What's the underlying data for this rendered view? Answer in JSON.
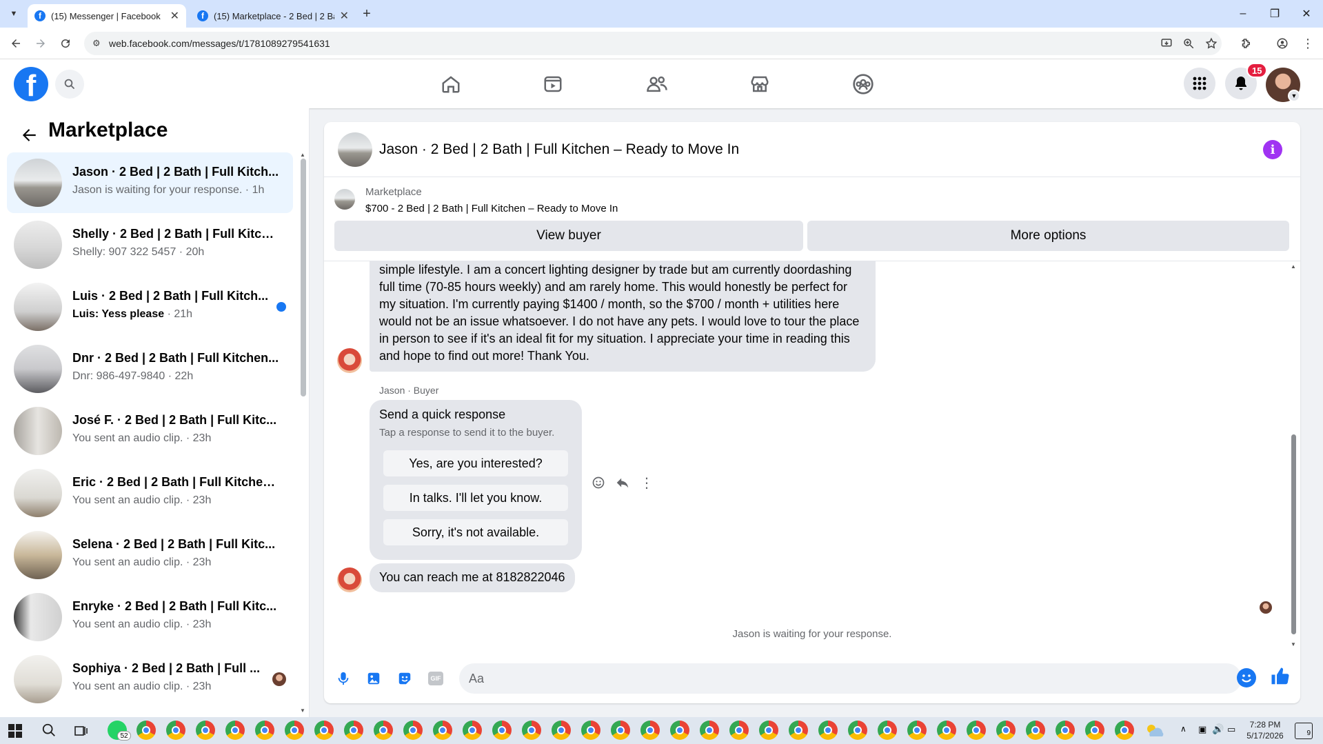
{
  "browser": {
    "tabs": [
      {
        "title": "(15) Messenger | Facebook",
        "active": true
      },
      {
        "title": "(15) Marketplace - 2 Bed | 2 Bat",
        "active": false
      }
    ],
    "url": "web.facebook.com/messages/t/1781089279541631"
  },
  "header": {
    "notification_count": "15",
    "nav_icons": [
      "home-icon",
      "video-icon",
      "friends-icon",
      "marketplace-icon",
      "groups-icon"
    ]
  },
  "sidebar": {
    "title": "Marketplace",
    "conversations": [
      {
        "name": "Jason · 2 Bed | 2 Bath | Full Kitch...",
        "snippet": "Jason is waiting for your response.",
        "time": "1h",
        "unread": false,
        "active": true
      },
      {
        "name": "Shelly · 2 Bed | 2 Bath | Full Kitch...",
        "snippet": "Shelly: 907 322 5457",
        "time": "20h",
        "unread": false,
        "active": false
      },
      {
        "name": "Luis · 2 Bed | 2 Bath | Full Kitch...",
        "snippet": "Luis: Yess please",
        "time": "21h",
        "unread": true,
        "active": false
      },
      {
        "name": "Dnr · 2 Bed | 2 Bath | Full Kitchen...",
        "snippet": "Dnr: 986-497-9840",
        "time": "22h",
        "unread": false,
        "active": false
      },
      {
        "name": "José F. · 2 Bed | 2 Bath | Full Kitc...",
        "snippet": "You sent an audio clip.",
        "time": "23h",
        "unread": false,
        "active": false
      },
      {
        "name": "Eric · 2 Bed | 2 Bath | Full Kitchen...",
        "snippet": "You sent an audio clip.",
        "time": "23h",
        "unread": false,
        "active": false
      },
      {
        "name": "Selena · 2 Bed | 2 Bath | Full Kitc...",
        "snippet": "You sent an audio clip.",
        "time": "23h",
        "unread": false,
        "active": false
      },
      {
        "name": "Enryke · 2 Bed | 2 Bath | Full Kitc...",
        "snippet": "You sent an audio clip.",
        "time": "23h",
        "unread": false,
        "active": false
      },
      {
        "name": "Sophiya · 2 Bed | 2 Bath | Full ...",
        "snippet": "You sent an audio clip.",
        "time": "23h",
        "unread": false,
        "active": false
      }
    ]
  },
  "chat": {
    "title": "Jason · 2 Bed | 2 Bath | Full Kitchen – Ready to Move In",
    "marketplace_label": "Marketplace",
    "listing": "$700 - 2 Bed | 2 Bath | Full Kitchen – Ready to Move In",
    "view_buyer": "View buyer",
    "more_options": "More options",
    "long_message": "simple lifestyle. I am a concert lighting designer by trade but am currently doordashing full time (70-85 hours weekly) and am rarely home. This would honestly be perfect for my situation. I'm currently paying $1400 / month, so the $700 / month + utilities here would not be an issue whatsoever. I do not have any pets. I would love to tour the place in person to see if it's an ideal fit for my situation. I appreciate your time in reading this and hope to find out more! Thank You.",
    "sender_label": "Jason · Buyer",
    "quick_response": {
      "title": "Send a quick response",
      "subtitle": "Tap a response to send it to the buyer.",
      "options": [
        "Yes, are you interested?",
        "In talks. I'll let you know.",
        "Sorry, it's not available."
      ]
    },
    "reach_message": "You can reach me at 8182822046",
    "waiting": "Jason is waiting for your response.",
    "composer_placeholder": "Aa"
  },
  "taskbar": {
    "badge": "52",
    "time": "7:28 PM",
    "date": "5/17/2026",
    "notif": "9"
  },
  "colors": {
    "fb_blue": "#1877f2",
    "bubble": "#e4e6eb",
    "active_row": "#ebf5ff",
    "badge_red": "#e41e3f",
    "info_purple": "#a033f2"
  }
}
